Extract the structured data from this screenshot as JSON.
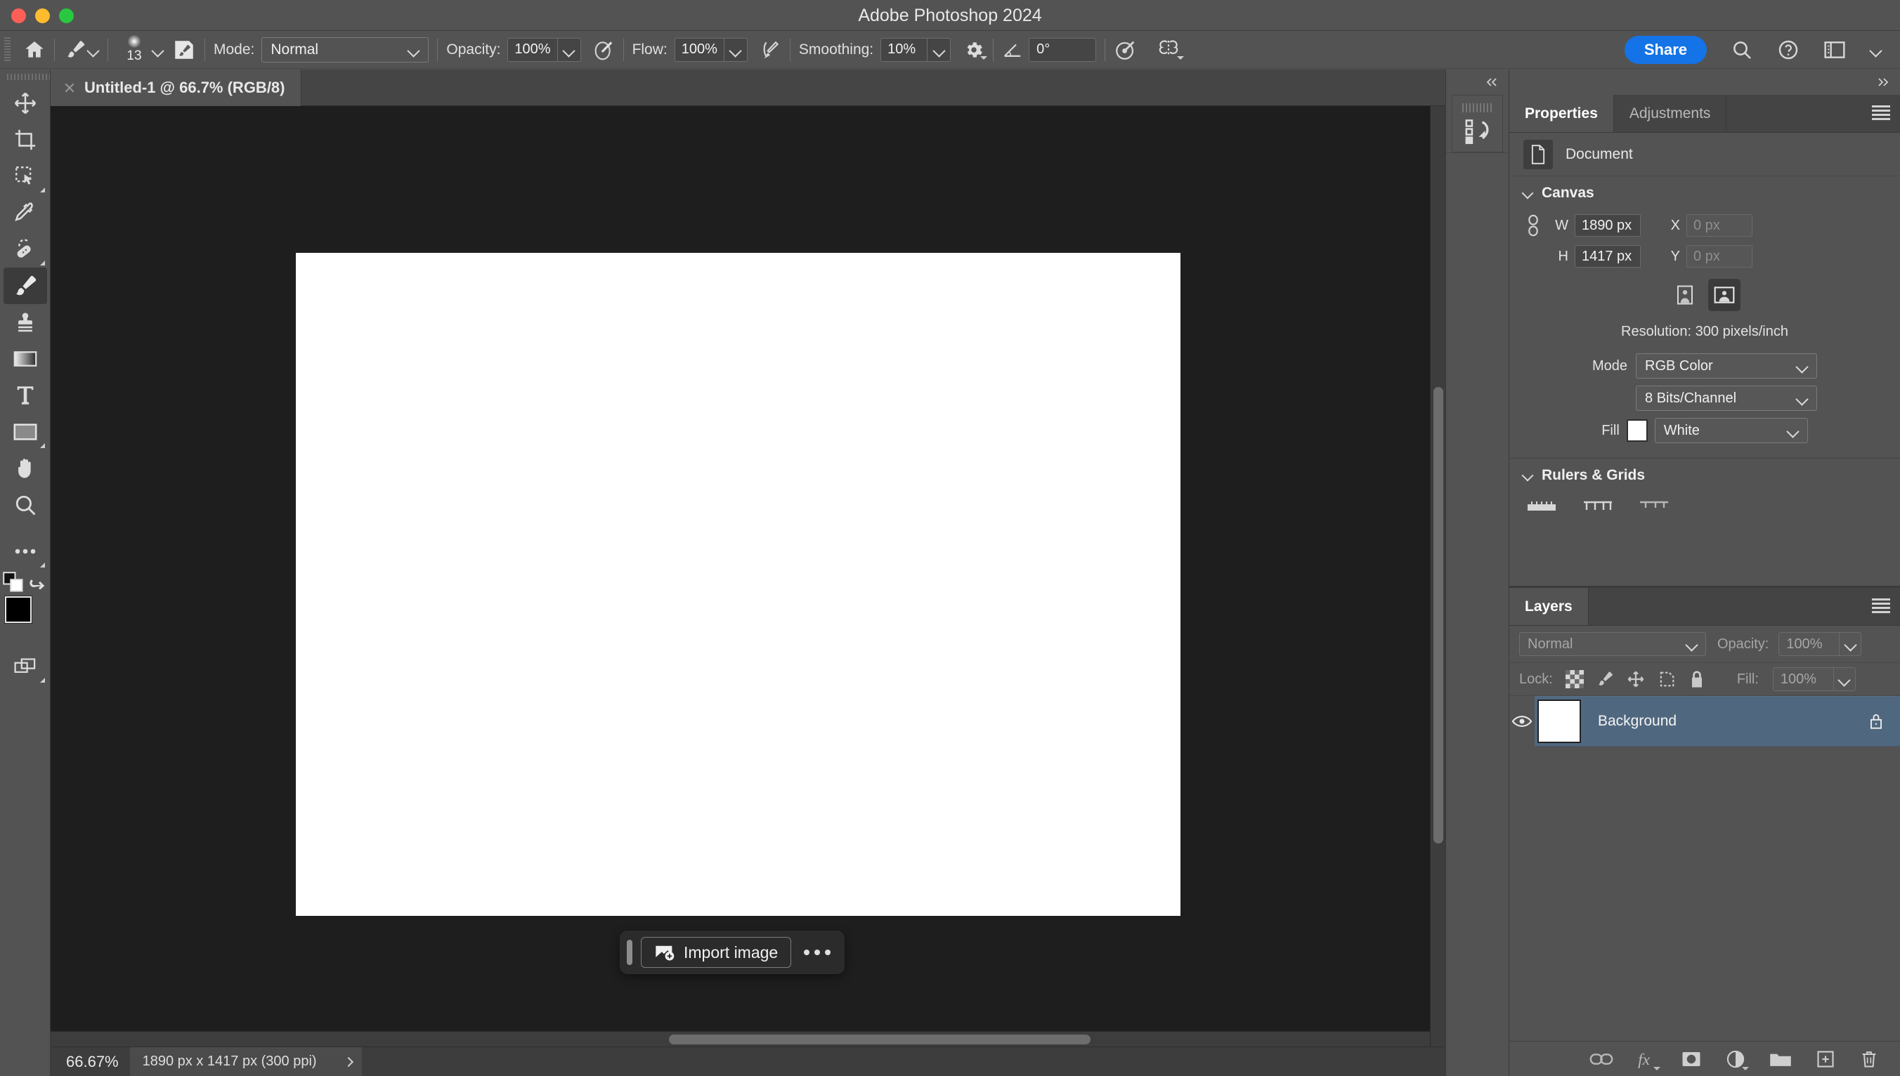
{
  "window": {
    "app_title": "Adobe Photoshop 2024",
    "traffic_lights": [
      "close",
      "minimize",
      "maximize"
    ]
  },
  "options_bar": {
    "home_icon": "home-icon",
    "tool_preset_icon": "brush-tool-icon",
    "brush_size": "13",
    "brush_panel_icon": "brush-settings-panel-icon",
    "mode_label": "Mode:",
    "mode_value": "Normal",
    "opacity_label": "Opacity:",
    "opacity_value": "100%",
    "opacity_pressure_icon": "pressure-opacity-icon",
    "flow_label": "Flow:",
    "flow_value": "100%",
    "airbrush_icon": "airbrush-icon",
    "smoothing_label": "Smoothing:",
    "smoothing_value": "10%",
    "smoothing_options_icon": "gear-icon",
    "angle_icon": "angle-icon",
    "angle_value": "0°",
    "pressure_size_icon": "pressure-size-icon",
    "symmetry_icon": "butterfly-symmetry-icon",
    "share_label": "Share",
    "search_icon": "search-icon",
    "help_icon": "help-icon",
    "workspace_icon": "workspace-switcher-icon",
    "workspace_chevron": "chevron-down-icon"
  },
  "document_tab": {
    "close_icon": "close-icon",
    "title": "Untitled-1 @ 66.7% (RGB/8)"
  },
  "toolbar": {
    "tools": [
      {
        "name": "move-tool",
        "icon": "move-icon",
        "active": false,
        "has_flyout": false
      },
      {
        "name": "crop-tool",
        "icon": "crop-icon",
        "active": false,
        "has_flyout": false
      },
      {
        "name": "object-selection-tool",
        "icon": "object-selection-icon",
        "active": false,
        "has_flyout": true
      },
      {
        "name": "eyedropper-tool",
        "icon": "eyedropper-icon",
        "active": false,
        "has_flyout": false
      },
      {
        "name": "healing-brush-tool",
        "icon": "healing-brush-icon",
        "active": false,
        "has_flyout": true
      },
      {
        "name": "brush-tool",
        "icon": "brush-icon",
        "active": true,
        "has_flyout": false
      },
      {
        "name": "clone-stamp-tool",
        "icon": "clone-stamp-icon",
        "active": false,
        "has_flyout": false
      },
      {
        "name": "gradient-tool",
        "icon": "gradient-icon",
        "active": false,
        "has_flyout": false
      },
      {
        "name": "type-tool",
        "icon": "type-icon",
        "active": false,
        "has_flyout": false
      },
      {
        "name": "rectangle-tool",
        "icon": "rectangle-icon",
        "active": false,
        "has_flyout": true
      },
      {
        "name": "hand-tool",
        "icon": "hand-icon",
        "active": false,
        "has_flyout": false
      },
      {
        "name": "zoom-tool",
        "icon": "magnifier-icon",
        "active": false,
        "has_flyout": false
      },
      {
        "name": "edit-toolbar-tool",
        "icon": "ellipsis-icon",
        "active": false,
        "has_flyout": true
      }
    ],
    "default_colors_icon": "default-colors-icon",
    "swap_colors_icon": "swap-colors-icon",
    "foreground_color": "#000000",
    "background_color": "#ffffff",
    "screen_mode_icon": "screen-mode-icon"
  },
  "canvas": {
    "background_color": "#1e1e1e",
    "artboard_color": "#ffffff",
    "scrollbar_thumb_color": "#6d6d6d"
  },
  "task_bar": {
    "drag_handle_icon": "drag-handle-icon",
    "import_icon": "import-image-icon",
    "import_label": "Import image",
    "more_icon": "ellipsis-icon"
  },
  "status_bar": {
    "zoom": "66.67%",
    "doc_info": "1890 px x 1417 px (300 ppi)",
    "expand_icon": "chevron-right-icon"
  },
  "collapsed_dock": {
    "expand_icon": "double-chevron-left-icon",
    "panels": [
      {
        "name": "history-panel",
        "icon": "history-icon"
      }
    ]
  },
  "right_dock": {
    "collapse_icon": "double-chevron-right-icon",
    "menu_icon": "panel-menu-icon",
    "tabs": [
      {
        "label": "Properties",
        "active": true
      },
      {
        "label": "Adjustments",
        "active": false
      }
    ],
    "properties": {
      "doc_icon": "document-icon",
      "doc_label": "Document",
      "canvas_section": {
        "title": "Canvas",
        "link_icon": "link-dimensions-icon",
        "w_label": "W",
        "w_value": "1890 px",
        "x_label": "X",
        "x_placeholder": "0 px",
        "h_label": "H",
        "h_value": "1417 px",
        "y_label": "Y",
        "y_placeholder": "0 px",
        "orientation": [
          {
            "name": "portrait-orientation",
            "icon": "portrait-icon",
            "active": false
          },
          {
            "name": "landscape-orientation",
            "icon": "landscape-icon",
            "active": true
          }
        ],
        "resolution": "Resolution: 300 pixels/inch",
        "mode_label": "Mode",
        "mode_value": "RGB Color",
        "depth_value": "8 Bits/Channel",
        "fill_label": "Fill",
        "fill_swatch": "#ffffff",
        "fill_value": "White"
      },
      "rulers_section": {
        "title": "Rulers & Grids",
        "icons": [
          "rulers-icon",
          "grid-icon",
          "guides-icon"
        ]
      }
    },
    "layers": {
      "tabs": [
        {
          "label": "Layers",
          "active": true
        }
      ],
      "menu_icon": "panel-menu-icon",
      "blend_mode": "Normal",
      "opacity_label": "Opacity:",
      "opacity_value": "100%",
      "lock_label": "Lock:",
      "lock_icons": [
        {
          "name": "lock-transparent-pixels",
          "icon": "checkerboard-icon"
        },
        {
          "name": "lock-image-pixels",
          "icon": "brush-icon"
        },
        {
          "name": "lock-position",
          "icon": "move-icon"
        },
        {
          "name": "lock-artboard-nesting",
          "icon": "artboard-icon"
        },
        {
          "name": "lock-all",
          "icon": "lock-icon"
        }
      ],
      "fill_label": "Fill:",
      "fill_value": "100%",
      "rows": [
        {
          "visible": true,
          "visibility_icon": "eye-icon",
          "thumbnail_color": "#ffffff",
          "name": "Background",
          "locked": true,
          "lock_icon": "lock-icon",
          "selected": true,
          "selected_color": "#50687f"
        }
      ],
      "footer_icons": [
        {
          "name": "link-layers-button",
          "icon": "link-icon"
        },
        {
          "name": "layer-styles-button",
          "icon": "fx-icon"
        },
        {
          "name": "add-layer-mask-button",
          "icon": "mask-icon"
        },
        {
          "name": "adjustment-layer-button",
          "icon": "half-circle-icon"
        },
        {
          "name": "new-group-button",
          "icon": "folder-icon"
        },
        {
          "name": "new-layer-button",
          "icon": "plus-square-icon"
        },
        {
          "name": "delete-layer-button",
          "icon": "trash-icon"
        }
      ]
    }
  }
}
